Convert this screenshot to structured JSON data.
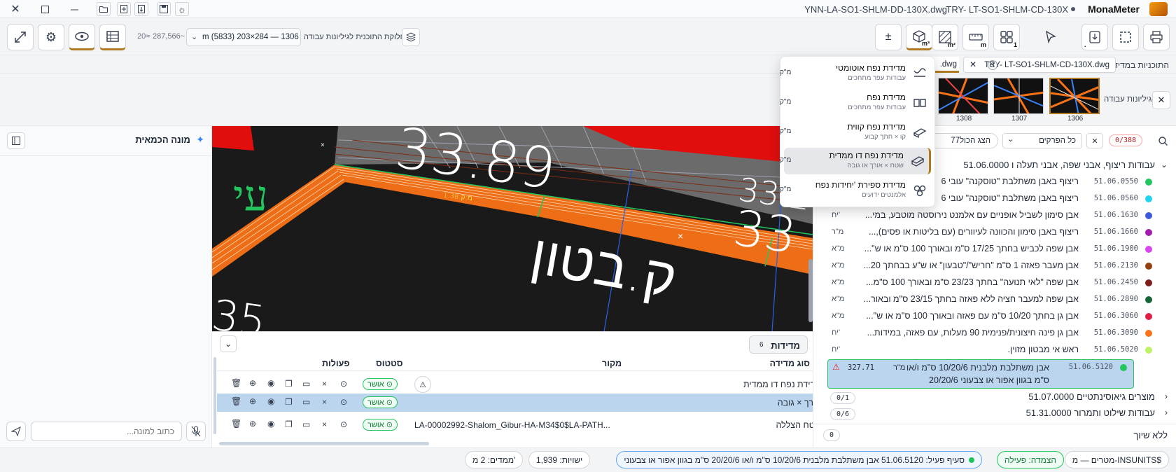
{
  "window": {
    "files": [
      "YNN-LA-SO1-SHLM-DD-130X.dwg",
      "TRY- LT-SO1-SHLM-CD-130X"
    ],
    "app_name": "MonaMeter"
  },
  "toolbar": {
    "coord_prefix": "20≈",
    "coord_value": "287,566~",
    "dims": "m (5833) 203×284 — 1306",
    "division_label": "חלוקת התוכנית לגיליונות עבודה",
    "plus_minus": "±",
    "sub_m3": "m³",
    "sub_m2": "m²",
    "sub_m": "m",
    "sub_1": "1"
  },
  "tabs": {
    "plans_label": "התוכניות במדידה",
    "tab1": "TRY- LT-SO1-SHLM-CD-130X.dwg",
    "tab1_count": "3",
    "tab2": ".dwg"
  },
  "sheets": {
    "label": "גיליונות עבודה",
    "items": [
      "1306",
      "1307",
      "1308"
    ]
  },
  "menu": {
    "items": [
      {
        "title": "מדידת נפח אוטומטי",
        "sub": "עבודות עפר מתחכים",
        "unit": "מ\"ק"
      },
      {
        "title": "מדידת נפח",
        "sub": "עבודות עפר מתחכים",
        "unit": "מ\"ק"
      },
      {
        "title": "מדידת נפח קווית",
        "sub": "קו × חתך קבוע",
        "unit": "מ\"ק"
      },
      {
        "title": "מדידת נפח דו ממדית",
        "sub": "שטח × אורך או גובה",
        "unit": "מ\"ק"
      },
      {
        "title": "מדידת ספירת 'יחידות נפח",
        "sub": "אלמנטים ידועים",
        "unit": "מ\"ק"
      }
    ]
  },
  "assistant": {
    "title": "מונה הכמאית",
    "placeholder": "כתוב למונה..."
  },
  "canvas": {
    "num1": "33.89",
    "num2": "33.2",
    "num3": "33",
    "num4": "35",
    "label_beton": "ק.בטון",
    "label_green": "עי",
    "annot": "מ:ק:1.38"
  },
  "measurements": {
    "title": "מדידות",
    "count": "6",
    "headers": {
      "name": "סוג מדידה",
      "source": "מקור",
      "status": "סטטוס",
      "actions": "פעולות"
    },
    "rows": [
      {
        "name": "מדידת נפח דו ממדית",
        "source": "",
        "status": "אושר"
      },
      {
        "name": "אורך × גובה",
        "source": "",
        "status": "אושר"
      },
      {
        "name": "שטח הצללה",
        "source": "LA-00002992-Shalom_Gibur-HA-M34$0$LA-PATH...",
        "status": "אושר"
      }
    ]
  },
  "boq": {
    "count_badge": "0/388",
    "filter": "כל הפרקים",
    "show_all": "הצג הכול77",
    "group1": "51.06.0000 עבודות ריצוף, אבני שפה, אבני תעלה ו",
    "items": [
      {
        "code": "51.06.0550",
        "text": "ריצוף באבן משתלבת \"טוסקנה\" עובי 6",
        "unit": "",
        "color": "#22c55e"
      },
      {
        "code": "51.06.0560",
        "text": "ריצוף באבן משתלבת \"טוסקנה\" עובי 6",
        "unit": "",
        "color": "#22d3ee"
      },
      {
        "code": "51.06.1630",
        "text": "אבן סימון לשביל אופניים עם אלמנט נירוסטה מוטבע, במי...",
        "unit": "יח'",
        "color": "#3b5bdb"
      },
      {
        "code": "51.06.1660",
        "text": "ריצוף באבן סימון והכוונה לעיוורים (עם בליטות או פסים),...",
        "unit": "מ\"ר",
        "color": "#a21caf"
      },
      {
        "code": "51.06.1900",
        "text": "אבן שפה לכביש בחתך 17/25 ס\"מ ובאורך 100 ס\"מ או ש\"...",
        "unit": "מ\"א",
        "color": "#d946ef"
      },
      {
        "code": "51.06.2130",
        "text": "אבן מעבר פאזה 1 ס\"מ \"חריש\"/\"טבעון\" או ש\"ע בבחתך 20...",
        "unit": "מ\"א",
        "color": "#92400e"
      },
      {
        "code": "51.06.2450",
        "text": "אבן שפה \"לאי תנועה\" בחתך 23/23 ס\"מ ובאורך 100 ס\"מ...",
        "unit": "מ\"א",
        "color": "#7f1d1d"
      },
      {
        "code": "51.06.2890",
        "text": "אבן שפה למעבר חציה ללא פאזה בחתך 23/15 ס\"מ ובאור...",
        "unit": "מ\"א",
        "color": "#166534"
      },
      {
        "code": "51.06.3060",
        "text": "אבן גן בחתך 10/20 ס\"מ עם פאזה ובאורך 100 ס\"מ או ש\"...",
        "unit": "מ\"א",
        "color": "#e11d48"
      },
      {
        "code": "51.06.3090",
        "text": "אבן גן פינה חיצונית/פנימית 90 מעלות, עם פאזה, במידות...",
        "unit": "יח'",
        "color": "#f97316"
      },
      {
        "code": "51.06.5020",
        "text": "ראש אי מבטון מזוין.",
        "unit": "יח'",
        "color": "#bef264"
      }
    ],
    "selected": {
      "code": "51.06.5120",
      "line1": "אבן משתלבת מלבנית 10/20/6 ס\"מ ו/או",
      "line2": "20/20/6 ס\"מ בגוון אפור או צבעוני",
      "unit": "מ\"ר",
      "qty": "327.71",
      "color": "#22c55e"
    },
    "group2": {
      "label": "51.07.0000 מוצרים גיאוסינתטיים",
      "count": "0/1"
    },
    "group3": {
      "label": "51.31.0000 עבודות שילוט ותמרור",
      "count": "0/6"
    },
    "unassigned": {
      "label": "ללא שיוך",
      "count": "0"
    }
  },
  "status": {
    "units": "מטרים — מ-INSUNITS$",
    "lock": "הצמדה: פעילה",
    "active": "סעיף פעיל: 51.06.5120 אבן משתלבת מלבנית 10/20/6 ס\"מ ו/או 20/20/6 ס\"מ בגוון אפור או צבעוני",
    "entities": "ישויות: 1,939",
    "dims": "ממדים: 2 מ'"
  }
}
